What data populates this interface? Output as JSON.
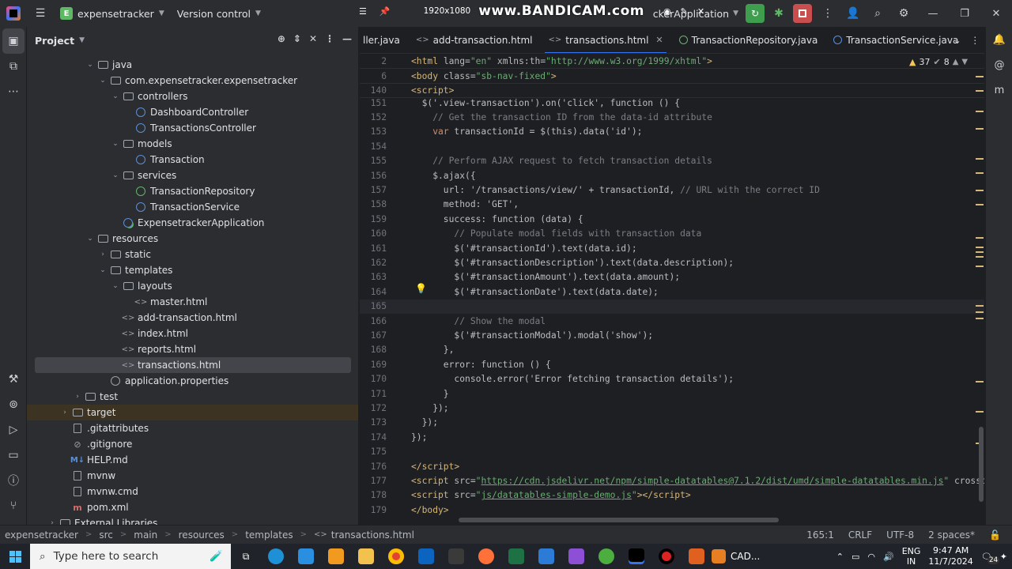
{
  "titlebar": {
    "project_badge": "E",
    "project_name": "expensetracker",
    "vcs": "Version control",
    "run_config": "ckerApplication",
    "recording_resolution": "1920x1080",
    "recording_brand": "www.BANDICAM.com"
  },
  "project_panel": {
    "title": "Project",
    "tree": [
      {
        "label": "java",
        "indent": 3,
        "icon": "folder",
        "arrow": "open"
      },
      {
        "label": "com.expensetracker.expensetracker",
        "indent": 4,
        "icon": "folder",
        "arrow": "open"
      },
      {
        "label": "controllers",
        "indent": 5,
        "icon": "folder",
        "arrow": "open"
      },
      {
        "label": "DashboardController",
        "indent": 6,
        "icon": "class",
        "arrow": ""
      },
      {
        "label": "TransactionsController",
        "indent": 6,
        "icon": "class",
        "arrow": ""
      },
      {
        "label": "models",
        "indent": 5,
        "icon": "folder",
        "arrow": "open"
      },
      {
        "label": "Transaction",
        "indent": 6,
        "icon": "class",
        "arrow": ""
      },
      {
        "label": "services",
        "indent": 5,
        "icon": "folder",
        "arrow": "open"
      },
      {
        "label": "TransactionRepository",
        "indent": 6,
        "icon": "iface",
        "arrow": ""
      },
      {
        "label": "TransactionService",
        "indent": 6,
        "icon": "class",
        "arrow": ""
      },
      {
        "label": "ExpensetrackerApplication",
        "indent": 5,
        "icon": "app",
        "arrow": ""
      },
      {
        "label": "resources",
        "indent": 3,
        "icon": "folder",
        "arrow": "open"
      },
      {
        "label": "static",
        "indent": 4,
        "icon": "folder",
        "arrow": "closed"
      },
      {
        "label": "templates",
        "indent": 4,
        "icon": "folder",
        "arrow": "open"
      },
      {
        "label": "layouts",
        "indent": 5,
        "icon": "folder",
        "arrow": "open"
      },
      {
        "label": "master.html",
        "indent": 6,
        "icon": "html",
        "arrow": ""
      },
      {
        "label": "add-transaction.html",
        "indent": 5,
        "icon": "html",
        "arrow": ""
      },
      {
        "label": "index.html",
        "indent": 5,
        "icon": "html",
        "arrow": ""
      },
      {
        "label": "reports.html",
        "indent": 5,
        "icon": "html",
        "arrow": ""
      },
      {
        "label": "transactions.html",
        "indent": 5,
        "icon": "html",
        "arrow": "",
        "selected": true
      },
      {
        "label": "application.properties",
        "indent": 4,
        "icon": "props",
        "arrow": ""
      },
      {
        "label": "test",
        "indent": 2,
        "icon": "folder",
        "arrow": "closed"
      },
      {
        "label": "target",
        "indent": 1,
        "icon": "folder",
        "arrow": "closed",
        "highlight": true
      },
      {
        "label": ".gitattributes",
        "indent": 1,
        "icon": "file",
        "arrow": ""
      },
      {
        "label": ".gitignore",
        "indent": 1,
        "icon": "git",
        "arrow": ""
      },
      {
        "label": "HELP.md",
        "indent": 1,
        "icon": "md",
        "arrow": ""
      },
      {
        "label": "mvnw",
        "indent": 1,
        "icon": "file",
        "arrow": ""
      },
      {
        "label": "mvnw.cmd",
        "indent": 1,
        "icon": "file",
        "arrow": ""
      },
      {
        "label": "pom.xml",
        "indent": 1,
        "icon": "maven",
        "arrow": ""
      },
      {
        "label": "External Libraries",
        "indent": 0,
        "icon": "folder",
        "arrow": "closed"
      }
    ]
  },
  "tabs": [
    {
      "label": "ller.java",
      "icon": "none",
      "active": false
    },
    {
      "label": "add-transaction.html",
      "icon": "html",
      "active": false
    },
    {
      "label": "transactions.html",
      "icon": "html",
      "active": true
    },
    {
      "label": "TransactionRepository.java",
      "icon": "iface",
      "active": false
    },
    {
      "label": "TransactionService.java",
      "icon": "class",
      "active": false
    }
  ],
  "inspections": {
    "warnings": "37",
    "weak": "8"
  },
  "editor": {
    "sticky": [
      {
        "n": "2",
        "html": "<span class=\"tok-tag\">&lt;html</span> <span class=\"tok-attr\">lang</span>=<span class=\"tok-str\">\"en\"</span> <span class=\"tok-attr\">xmlns:th</span>=<span class=\"tok-str\">\"http://www.w3.org/1999/xhtml\"</span><span class=\"tok-tag\">&gt;</span>"
      },
      {
        "n": "6",
        "html": "<span class=\"tok-tag\">&lt;body</span> <span class=\"tok-attr\">class</span>=<span class=\"tok-str\">\"sb-nav-fixed\"</span><span class=\"tok-tag\">&gt;</span>"
      },
      {
        "n": "140",
        "html": "<span class=\"tok-tag\">&lt;script&gt;</span>"
      }
    ],
    "lines": [
      {
        "n": "151",
        "html": "  $('.view-transaction').on('click', function () {"
      },
      {
        "n": "152",
        "html": "    <span class=\"tok-com\">// Get the transaction ID from the data-id attribute</span>"
      },
      {
        "n": "153",
        "html": "    <span class=\"tok-kw\">var</span> transactionId = $(this).data('id');"
      },
      {
        "n": "154",
        "html": ""
      },
      {
        "n": "155",
        "html": "    <span class=\"tok-com\">// Perform AJAX request to fetch transaction details</span>"
      },
      {
        "n": "156",
        "html": "    $.ajax({"
      },
      {
        "n": "157",
        "html": "      url: '/transactions/view/' + transactionId, <span class=\"tok-com\">// URL with the correct ID</span>"
      },
      {
        "n": "158",
        "html": "      method: 'GET',"
      },
      {
        "n": "159",
        "html": "      success: function (data) {"
      },
      {
        "n": "160",
        "html": "        <span class=\"tok-com\">// Populate modal fields with transaction data</span>"
      },
      {
        "n": "161",
        "html": "        $('#transactionId').text(data.id);"
      },
      {
        "n": "162",
        "html": "        $('#transactionDescription').text(data.description);"
      },
      {
        "n": "163",
        "html": "        $('#transactionAmount').text(data.amount);"
      },
      {
        "n": "164",
        "html": "        $('#transactionDate').text(data.date);"
      },
      {
        "n": "165",
        "html": "",
        "current": true
      },
      {
        "n": "166",
        "html": "        <span class=\"tok-com\">// Show the modal</span>"
      },
      {
        "n": "167",
        "html": "        $('#transactionModal').modal('show');"
      },
      {
        "n": "168",
        "html": "      },"
      },
      {
        "n": "169",
        "html": "      error: function () {"
      },
      {
        "n": "170",
        "html": "        console.error('Error fetching transaction details');"
      },
      {
        "n": "171",
        "html": "      }"
      },
      {
        "n": "172",
        "html": "    });"
      },
      {
        "n": "173",
        "html": "  });"
      },
      {
        "n": "174",
        "html": "});"
      },
      {
        "n": "175",
        "html": ""
      },
      {
        "n": "176",
        "html": "<span class=\"tok-tag\">&lt;/script&gt;</span>"
      },
      {
        "n": "177",
        "html": "<span class=\"tok-tag\">&lt;script</span> <span class=\"tok-attr\">src</span>=<span class=\"tok-str\">\"</span><span class=\"tok-url\">https://cdn.jsdelivr.net/npm/simple-datatables@7.1.2/dist/umd/simple-datatables.min.js</span><span class=\"tok-str\">\"</span> <span class=\"tok-attr\">crossori</span>"
      },
      {
        "n": "178",
        "html": "<span class=\"tok-tag\">&lt;script</span> <span class=\"tok-attr\">src</span>=<span class=\"tok-str\">\"</span><span class=\"tok-url\">js/datatables-simple-demo.js</span><span class=\"tok-str\">\"</span><span class=\"tok-tag\">&gt;&lt;/script&gt;</span>"
      },
      {
        "n": "179",
        "html": "<span class=\"tok-tag\">&lt;/body&gt;</span>"
      }
    ]
  },
  "statusbar": {
    "crumbs": [
      "expensetracker",
      "src",
      "main",
      "resources",
      "templates",
      "transactions.html"
    ],
    "position": "165:1",
    "line_sep": "CRLF",
    "encoding": "UTF-8",
    "indent": "2 spaces*"
  },
  "taskbar": {
    "search_placeholder": "Type here to search",
    "cad_label": "CAD...",
    "lang_top": "ENG",
    "lang_bottom": "IN",
    "time": "9:47 AM",
    "date": "11/7/2024",
    "notif_count": "24"
  },
  "colors": {
    "accent": "#3574f0",
    "bg": "#1e1f22",
    "panel": "#2b2d30",
    "run_green": "#3f9e4e",
    "stop_red": "#c94f4f"
  }
}
